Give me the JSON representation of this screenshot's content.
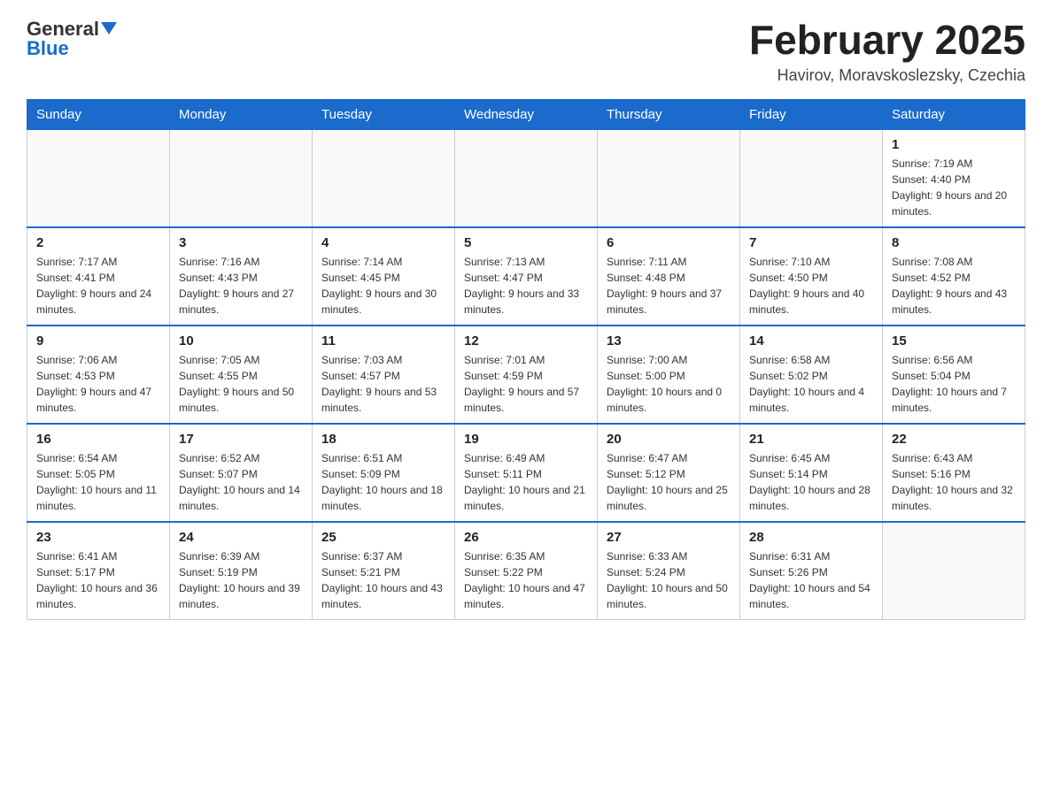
{
  "header": {
    "logo_general": "General",
    "logo_blue": "Blue",
    "title": "February 2025",
    "location": "Havirov, Moravskoslezsky, Czechia"
  },
  "weekdays": [
    "Sunday",
    "Monday",
    "Tuesday",
    "Wednesday",
    "Thursday",
    "Friday",
    "Saturday"
  ],
  "weeks": [
    [
      {
        "day": "",
        "info": ""
      },
      {
        "day": "",
        "info": ""
      },
      {
        "day": "",
        "info": ""
      },
      {
        "day": "",
        "info": ""
      },
      {
        "day": "",
        "info": ""
      },
      {
        "day": "",
        "info": ""
      },
      {
        "day": "1",
        "info": "Sunrise: 7:19 AM\nSunset: 4:40 PM\nDaylight: 9 hours and 20 minutes."
      }
    ],
    [
      {
        "day": "2",
        "info": "Sunrise: 7:17 AM\nSunset: 4:41 PM\nDaylight: 9 hours and 24 minutes."
      },
      {
        "day": "3",
        "info": "Sunrise: 7:16 AM\nSunset: 4:43 PM\nDaylight: 9 hours and 27 minutes."
      },
      {
        "day": "4",
        "info": "Sunrise: 7:14 AM\nSunset: 4:45 PM\nDaylight: 9 hours and 30 minutes."
      },
      {
        "day": "5",
        "info": "Sunrise: 7:13 AM\nSunset: 4:47 PM\nDaylight: 9 hours and 33 minutes."
      },
      {
        "day": "6",
        "info": "Sunrise: 7:11 AM\nSunset: 4:48 PM\nDaylight: 9 hours and 37 minutes."
      },
      {
        "day": "7",
        "info": "Sunrise: 7:10 AM\nSunset: 4:50 PM\nDaylight: 9 hours and 40 minutes."
      },
      {
        "day": "8",
        "info": "Sunrise: 7:08 AM\nSunset: 4:52 PM\nDaylight: 9 hours and 43 minutes."
      }
    ],
    [
      {
        "day": "9",
        "info": "Sunrise: 7:06 AM\nSunset: 4:53 PM\nDaylight: 9 hours and 47 minutes."
      },
      {
        "day": "10",
        "info": "Sunrise: 7:05 AM\nSunset: 4:55 PM\nDaylight: 9 hours and 50 minutes."
      },
      {
        "day": "11",
        "info": "Sunrise: 7:03 AM\nSunset: 4:57 PM\nDaylight: 9 hours and 53 minutes."
      },
      {
        "day": "12",
        "info": "Sunrise: 7:01 AM\nSunset: 4:59 PM\nDaylight: 9 hours and 57 minutes."
      },
      {
        "day": "13",
        "info": "Sunrise: 7:00 AM\nSunset: 5:00 PM\nDaylight: 10 hours and 0 minutes."
      },
      {
        "day": "14",
        "info": "Sunrise: 6:58 AM\nSunset: 5:02 PM\nDaylight: 10 hours and 4 minutes."
      },
      {
        "day": "15",
        "info": "Sunrise: 6:56 AM\nSunset: 5:04 PM\nDaylight: 10 hours and 7 minutes."
      }
    ],
    [
      {
        "day": "16",
        "info": "Sunrise: 6:54 AM\nSunset: 5:05 PM\nDaylight: 10 hours and 11 minutes."
      },
      {
        "day": "17",
        "info": "Sunrise: 6:52 AM\nSunset: 5:07 PM\nDaylight: 10 hours and 14 minutes."
      },
      {
        "day": "18",
        "info": "Sunrise: 6:51 AM\nSunset: 5:09 PM\nDaylight: 10 hours and 18 minutes."
      },
      {
        "day": "19",
        "info": "Sunrise: 6:49 AM\nSunset: 5:11 PM\nDaylight: 10 hours and 21 minutes."
      },
      {
        "day": "20",
        "info": "Sunrise: 6:47 AM\nSunset: 5:12 PM\nDaylight: 10 hours and 25 minutes."
      },
      {
        "day": "21",
        "info": "Sunrise: 6:45 AM\nSunset: 5:14 PM\nDaylight: 10 hours and 28 minutes."
      },
      {
        "day": "22",
        "info": "Sunrise: 6:43 AM\nSunset: 5:16 PM\nDaylight: 10 hours and 32 minutes."
      }
    ],
    [
      {
        "day": "23",
        "info": "Sunrise: 6:41 AM\nSunset: 5:17 PM\nDaylight: 10 hours and 36 minutes."
      },
      {
        "day": "24",
        "info": "Sunrise: 6:39 AM\nSunset: 5:19 PM\nDaylight: 10 hours and 39 minutes."
      },
      {
        "day": "25",
        "info": "Sunrise: 6:37 AM\nSunset: 5:21 PM\nDaylight: 10 hours and 43 minutes."
      },
      {
        "day": "26",
        "info": "Sunrise: 6:35 AM\nSunset: 5:22 PM\nDaylight: 10 hours and 47 minutes."
      },
      {
        "day": "27",
        "info": "Sunrise: 6:33 AM\nSunset: 5:24 PM\nDaylight: 10 hours and 50 minutes."
      },
      {
        "day": "28",
        "info": "Sunrise: 6:31 AM\nSunset: 5:26 PM\nDaylight: 10 hours and 54 minutes."
      },
      {
        "day": "",
        "info": ""
      }
    ]
  ]
}
